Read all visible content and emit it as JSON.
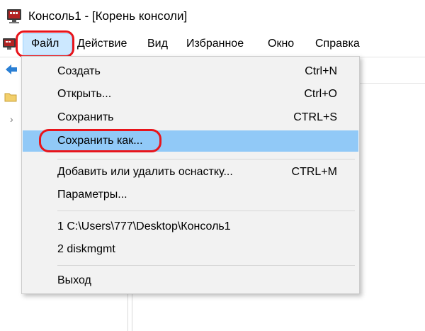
{
  "window": {
    "title": "Консоль1 - [Корень консоли]"
  },
  "menubar": {
    "items": [
      "Файл",
      "Действие",
      "Вид",
      "Избранное",
      "Окно",
      "Справка"
    ]
  },
  "file_menu": {
    "items": [
      {
        "label": "Создать",
        "shortcut": "Ctrl+N"
      },
      {
        "label": "Открыть...",
        "shortcut": "Ctrl+O"
      },
      {
        "label": "Сохранить",
        "shortcut": "CTRL+S"
      },
      {
        "label": "Сохранить как...",
        "shortcut": "",
        "highlighted": true
      },
      {
        "label": "Добавить или удалить оснастку...",
        "shortcut": "CTRL+M"
      },
      {
        "label": "Параметры...",
        "shortcut": ""
      },
      {
        "label": "1 C:\\Users\\777\\Desktop\\Консоль1",
        "shortcut": ""
      },
      {
        "label": "2 diskmgmt",
        "shortcut": ""
      },
      {
        "label": "Выход",
        "shortcut": ""
      }
    ]
  },
  "icons": {
    "app": "mmc-console-icon",
    "document": "console-document-icon",
    "back": "back-arrow-icon",
    "folder": "folder-icon",
    "expander": "chevron-right-icon"
  },
  "colors": {
    "annotation": "#e8141b",
    "menu_highlight": "#91c9f7",
    "menu_background": "#f2f2f2",
    "active_menu": "#cce8ff"
  },
  "tree": {
    "expander_glyph": "›"
  }
}
